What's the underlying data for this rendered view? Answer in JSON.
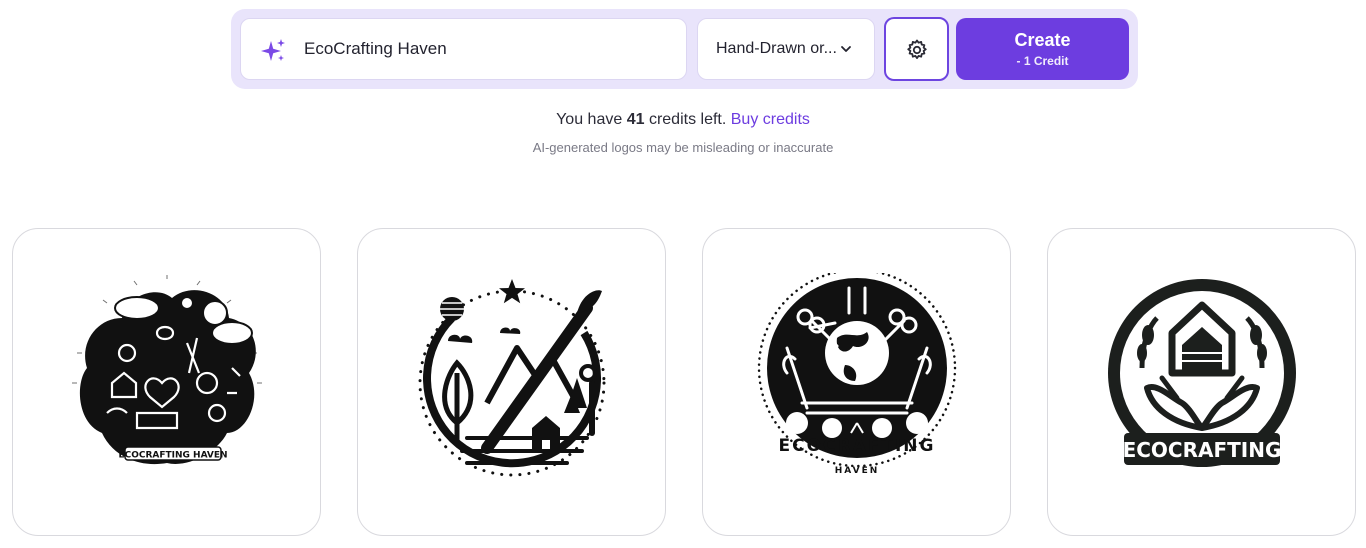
{
  "prompt": {
    "value": "EcoCrafting Haven"
  },
  "style_select": {
    "value": "Hand-Drawn or..."
  },
  "create": {
    "label": "Create",
    "cost": "- 1 Credit"
  },
  "credits": {
    "prefix": "You have",
    "count": "41",
    "suffix": "credits left.",
    "buy_link": "Buy credits"
  },
  "disclaimer": "AI-generated logos may be misleading or inaccurate",
  "logos": [
    {
      "text": "ECOCRAFTING HAVEN"
    },
    {
      "text": ""
    },
    {
      "text": "ECOCRAFTING",
      "subtext": "HAVEN"
    },
    {
      "text": "ECOCRAFTING"
    }
  ],
  "colors": {
    "accent": "#6d3de0",
    "bar_bg": "#e9e4fb"
  }
}
